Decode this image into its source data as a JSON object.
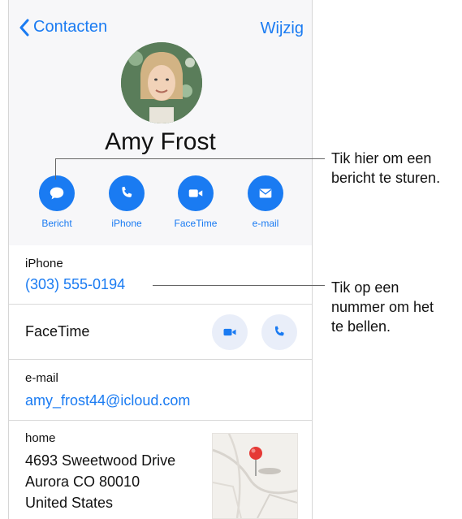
{
  "nav": {
    "back_label": "Contacten",
    "edit_label": "Wijzig"
  },
  "contact": {
    "name": "Amy Frost"
  },
  "actions": [
    {
      "label": "Bericht",
      "icon": "message-icon"
    },
    {
      "label": "iPhone",
      "icon": "phone-icon"
    },
    {
      "label": "FaceTime",
      "icon": "video-icon"
    },
    {
      "label": "e-mail",
      "icon": "mail-icon"
    }
  ],
  "phone_row": {
    "label": "iPhone",
    "value": "(303) 555-0194"
  },
  "facetime_row": {
    "label": "FaceTime"
  },
  "email_row": {
    "label": "e-mail",
    "value": "amy_frost44@icloud.com"
  },
  "home_row": {
    "label": "home",
    "lines": [
      "4693 Sweetwood Drive",
      "Aurora CO 80010",
      "United States"
    ]
  },
  "callouts": {
    "message": [
      "Tik hier om een",
      "bericht te sturen."
    ],
    "number": [
      "Tik op een",
      "nummer om het",
      "te bellen."
    ]
  },
  "colors": {
    "accent": "#1a7bf2",
    "header_bg": "#f7f7f9",
    "pin": "#e53935"
  }
}
